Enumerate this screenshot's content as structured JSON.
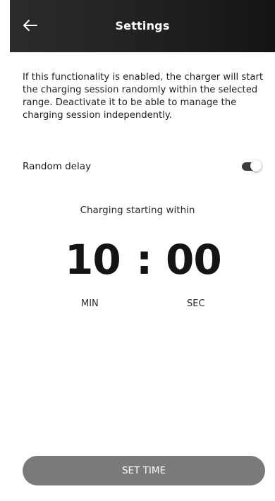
{
  "header": {
    "title": "Settings",
    "back_icon": "arrow-left-icon"
  },
  "description": "If this functionality is enabled, the charger will start the charging session randomly within the selected range. Deactivate it to be able to manage the charging session independently.",
  "random_delay": {
    "label": "Random delay",
    "enabled": true
  },
  "timer": {
    "title": "Charging starting within",
    "minutes": "10",
    "separator": ":",
    "seconds": "00",
    "minutes_label": "MIN",
    "seconds_label": "SEC"
  },
  "actions": {
    "set_time_label": "SET TIME"
  },
  "colors": {
    "header_bg": "#1f1f1f",
    "button_bg": "#7a7a7a",
    "toggle_track": "#3b3b3b"
  }
}
